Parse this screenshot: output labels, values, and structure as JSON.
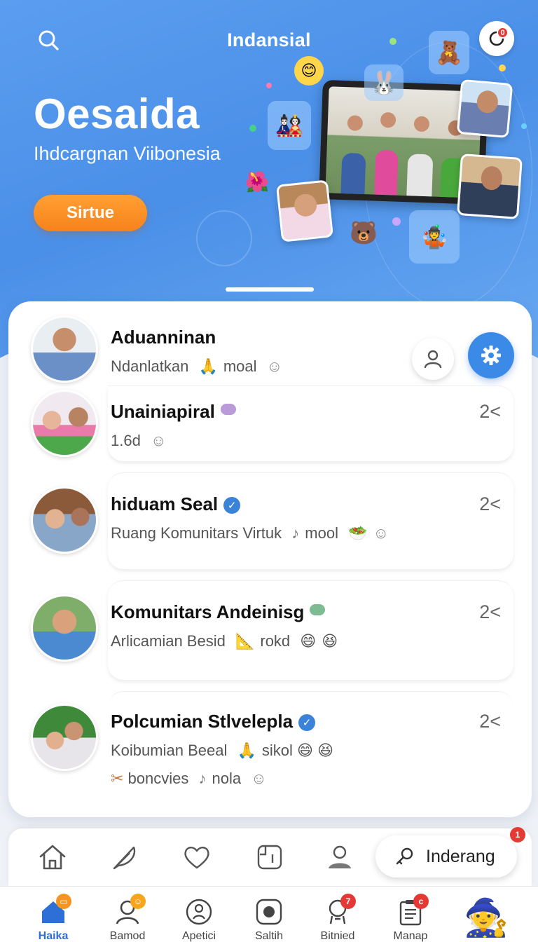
{
  "hero": {
    "app_title": "Indansial",
    "heading": "Oesaida",
    "subtitle": "Ihdcargnan Viibonesia",
    "cta_label": "Sirtue",
    "notification_count": "0"
  },
  "list": {
    "items": [
      {
        "title": "Aduanninan",
        "sub_parts": [
          "Ndanlatkan",
          "moal"
        ],
        "count": "",
        "verified": false
      },
      {
        "title": "Unainiapiral",
        "sub_parts": [
          "1.6d"
        ],
        "count": "2<",
        "verified": false
      },
      {
        "title": "hiduam Seal",
        "sub_parts": [
          "Ruang Komunitars Virtuk",
          "mool"
        ],
        "count": "2<",
        "verified": true
      },
      {
        "title": "Komunitars Andeinisg",
        "sub_parts": [
          "Arlicamian Besid",
          "rokd"
        ],
        "count": "2<",
        "verified": false
      },
      {
        "title": "Polcumian Stlvelepla",
        "sub_parts": [
          "Koibumian Beeal",
          "sikol"
        ],
        "sub2_parts": [
          "boncvies",
          "nola"
        ],
        "count": "2<",
        "verified": true
      }
    ]
  },
  "action_bar": {
    "search_label": "Inderang",
    "search_badge": "1"
  },
  "bottom_nav": {
    "items": [
      {
        "label": "Haika",
        "badge": "",
        "active": true
      },
      {
        "label": "Bamod",
        "badge": "",
        "active": false
      },
      {
        "label": "Apetici",
        "badge": "",
        "active": false
      },
      {
        "label": "Saltih",
        "badge": "",
        "active": false
      },
      {
        "label": "Bitnied",
        "badge": "7",
        "active": false
      },
      {
        "label": "Manap",
        "badge": "c",
        "active": false
      }
    ]
  },
  "colors": {
    "hero_blue": "#4a8fe8",
    "accent_orange": "#f7821b",
    "verified_blue": "#3b82d9",
    "badge_red": "#e53935"
  }
}
